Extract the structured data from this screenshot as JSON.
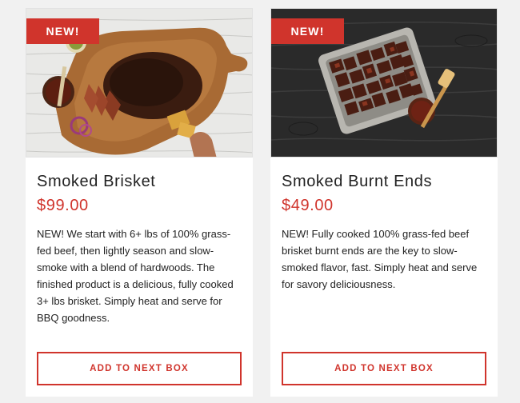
{
  "products": [
    {
      "badge": "NEW!",
      "title": "Smoked Brisket",
      "price": "$99.00",
      "description": "NEW! We start with 6+ lbs of 100% grass-fed beef, then lightly season and slow-smoke with a blend of hardwoods. The finished product is a delicious, fully cooked 3+ lbs brisket. Simply heat and serve for BBQ goodness.",
      "button_label": "ADD TO NEXT BOX",
      "image_icon": "brisket-on-cutting-board-photo"
    },
    {
      "badge": "NEW!",
      "title": "Smoked Burnt Ends",
      "price": "$49.00",
      "description": "NEW! Fully cooked 100% grass-fed beef brisket burnt ends are the key to slow-smoked flavor, fast. Simply heat and serve for savory deliciousness.",
      "button_label": "ADD TO NEXT BOX",
      "image_icon": "burnt-ends-tray-photo"
    }
  ],
  "colors": {
    "accent": "#d0342c",
    "page_background": "#f1f1f1",
    "card_background": "#ffffff",
    "text": "#222222"
  }
}
